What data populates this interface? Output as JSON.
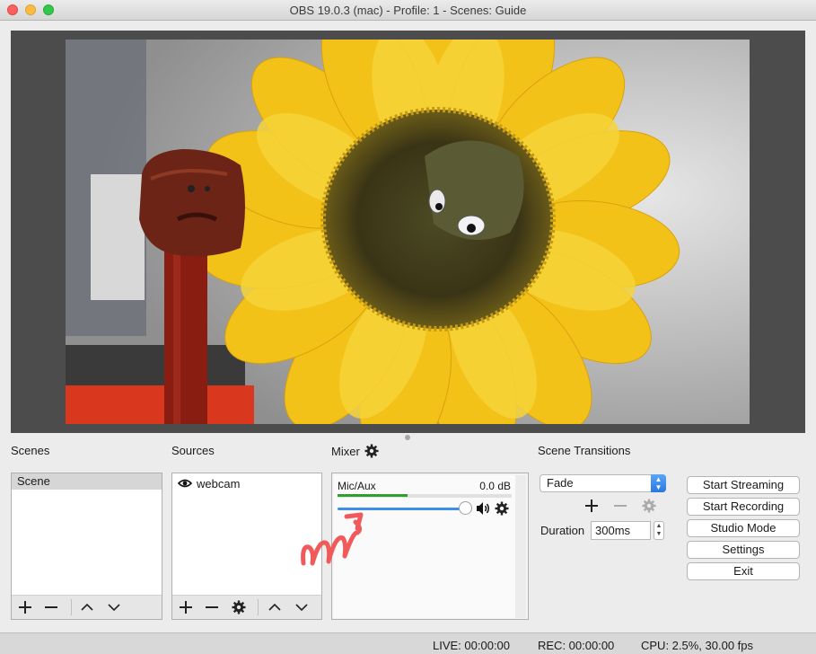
{
  "window": {
    "title": "OBS 19.0.3 (mac) - Profile: 1 - Scenes: Guide"
  },
  "docks": {
    "scenes": "Scenes",
    "sources": "Sources",
    "mixer": "Mixer",
    "transitions": "Scene Transitions"
  },
  "scenes": {
    "items": [
      "Scene"
    ]
  },
  "sources": {
    "items": [
      {
        "name": "webcam",
        "icon": "eye-icon"
      }
    ]
  },
  "mixer": {
    "channel": "Mic/Aux",
    "db": "0.0 dB",
    "meter_level": 0.4,
    "volume": 1.0,
    "icons": [
      "gear-icon",
      "speaker-icon"
    ]
  },
  "transitions": {
    "selected": "Fade",
    "duration_label": "Duration",
    "duration_value": "300ms"
  },
  "controls": {
    "start_streaming": "Start Streaming",
    "start_recording": "Start Recording",
    "studio_mode": "Studio Mode",
    "settings": "Settings",
    "exit": "Exit"
  },
  "status": {
    "live": "LIVE: 00:00:00",
    "rec": "REC: 00:00:00",
    "cpu": "CPU: 2.5%, 30.00 fps"
  },
  "colors": {
    "accent": "#3d8ee6",
    "meter": "#2fa02f",
    "annotation": "#f05a5a"
  }
}
